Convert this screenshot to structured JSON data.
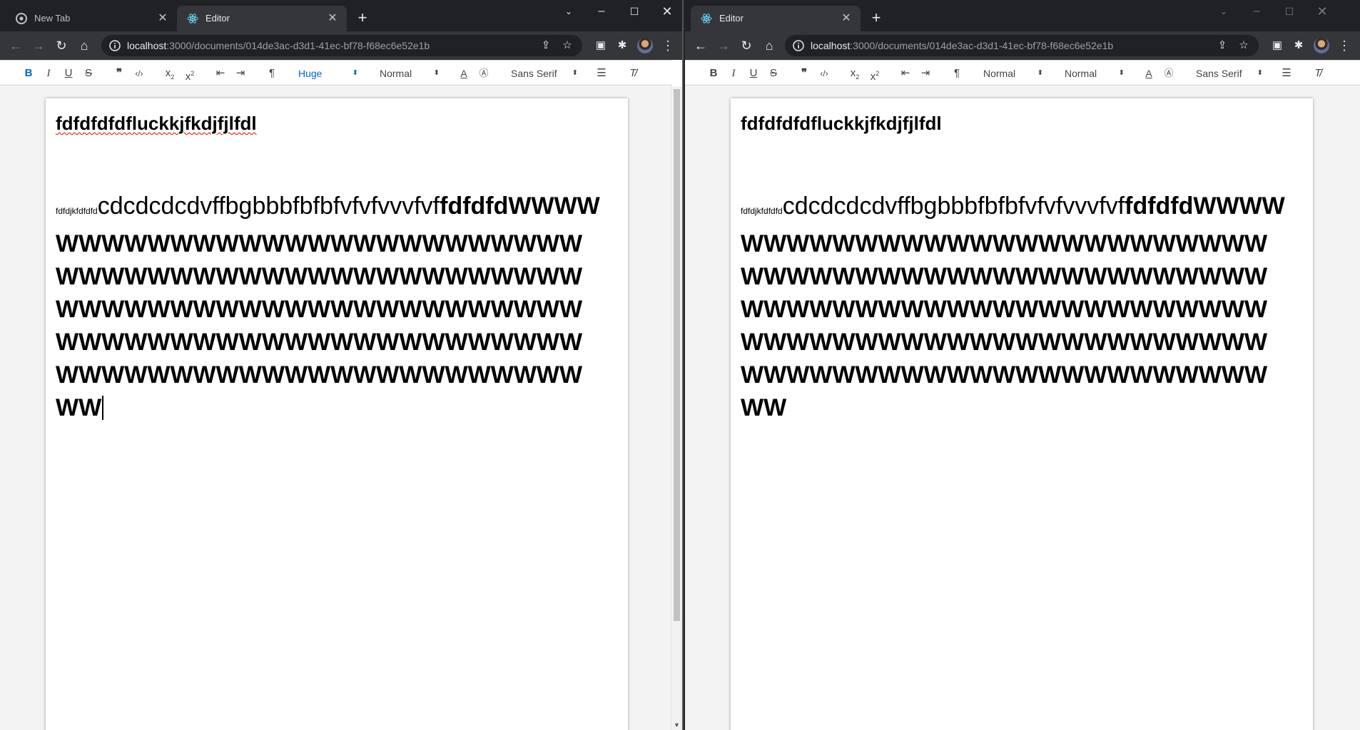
{
  "left_window": {
    "tabs": [
      {
        "title": "New Tab",
        "icon": "chrome-icon",
        "active": false
      },
      {
        "title": "Editor",
        "icon": "react-icon",
        "active": true
      }
    ],
    "url": {
      "host": "localhost",
      "path": ":3000/documents/014de3ac-d3d1-41ec-bf78-f68ec6e52e1b"
    },
    "toolbar": {
      "size_select": "Huge",
      "header_select": "Normal",
      "font_select": "Sans Serif",
      "bold_active": true
    },
    "doc": {
      "title": "fdfdfdfdfluckkjfkdjfjlfdl",
      "tiny_text": "fdfdjkfdfdfd",
      "normal_text": "cdcdcdcdvffbgbbbfbfbfvfvfvvvfvf",
      "bold_text": "fdfdfdWWWWWWWWWWWWWWWWWWWWWWWWWWWWWWWWWWWWWWWWWWWWWWWWWWWWWWWWWWWWWWWWWWWWWWWWWWWWWWWWWWWWWWWWWWWWWWWWWWWWWWWWWWWWWWWWWWWWWWWWW"
    }
  },
  "right_window": {
    "tabs": [
      {
        "title": "Editor",
        "icon": "react-icon",
        "active": true
      }
    ],
    "url": {
      "host": "localhost",
      "path": ":3000/documents/014de3ac-d3d1-41ec-bf78-f68ec6e52e1b"
    },
    "toolbar": {
      "size_select": "Normal",
      "header_select": "Normal",
      "font_select": "Sans Serif",
      "bold_active": false
    },
    "doc": {
      "title": "fdfdfdfdfluckkjfkdjfjlfdl",
      "tiny_text": "fdfdjkfdfdfd",
      "normal_text": "cdcdcdcdvffbgbbbfbfbfvfvfvvvfvf",
      "bold_text": "fdfdfdWWWWWWWWWWWWWWWWWWWWWWWWWWWWWWWWWWWWWWWWWWWWWWWWWWWWWWWWWWWWWWWWWWWWWWWWWWWWWWWWWWWWWWWWWWWWWWWWWWWWWWWWWWWWWWWWWWWWWWWWW"
    }
  },
  "colors": {
    "accent": "#0066cc",
    "chrome_dark": "#202124",
    "chrome_toolbar": "#35363a"
  }
}
